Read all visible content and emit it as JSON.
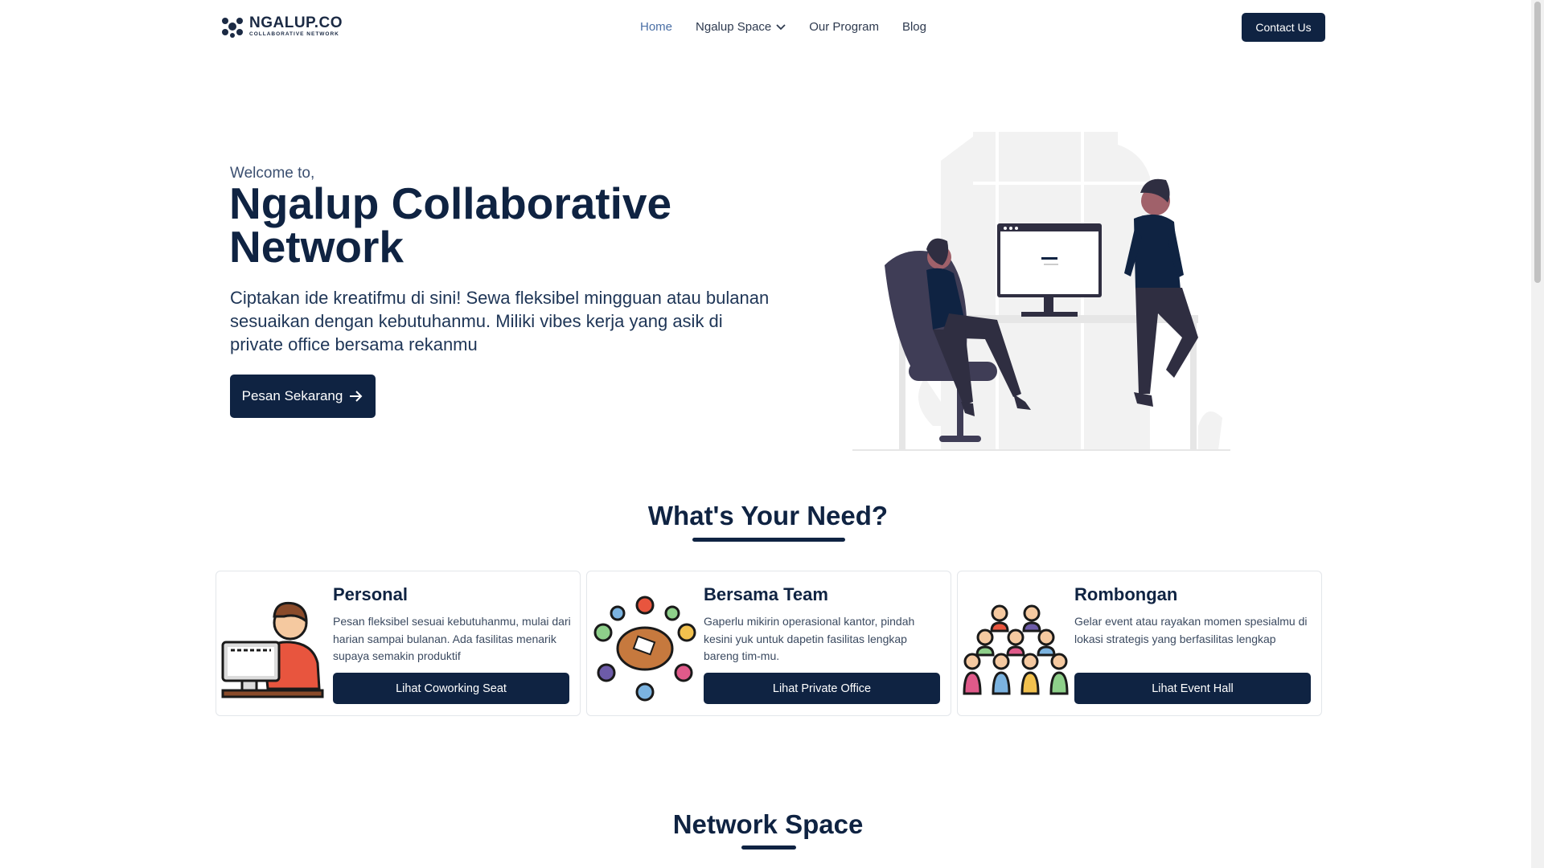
{
  "brand": {
    "name": "NGALUP.CO",
    "tagline": "COLLABORATIVE NETWORK"
  },
  "nav": {
    "items": [
      {
        "label": "Home",
        "active": true
      },
      {
        "label": "Ngalup Space",
        "dropdown": true
      },
      {
        "label": "Our Program"
      },
      {
        "label": "Blog"
      }
    ],
    "contact_label": "Contact Us"
  },
  "hero": {
    "welcome": "Welcome to,",
    "title": "Ngalup Collaborative Network",
    "description": "Ciptakan ide kreatifmu di sini! Sewa fleksibel mingguan atau bulanan sesuaikan dengan kebutuhanmu. Miliki vibes kerja yang asik di private office bersama rekanmu",
    "cta_label": "Pesan Sekarang"
  },
  "needs": {
    "title": "What's Your Need?",
    "cards": [
      {
        "icon": "person-computer-icon",
        "title": "Personal",
        "description": "Pesan fleksibel sesuai kebutuhanmu, mulai dari harian sampai bulanan. Ada fasilitas menarik supaya semakin produktif",
        "button": "Lihat Coworking Seat"
      },
      {
        "icon": "team-meeting-icon",
        "title": "Bersama Team",
        "description": "Gaperlu mikirin operasional kantor, pindah kesini yuk untuk dapetin fasilitas lengkap bareng tim-mu.",
        "button": "Lihat Private Office"
      },
      {
        "icon": "group-crowd-icon",
        "title": "Rombongan",
        "description": "Gelar event atau rayakan momen spesialmu di lokasi strategis yang berfasilitas lengkap",
        "button": "Lihat Event Hall"
      }
    ]
  },
  "network": {
    "title": "Network Space"
  },
  "colors": {
    "primary": "#0f2342",
    "accent": "#4a6fa5",
    "border": "#e3e6ea"
  }
}
